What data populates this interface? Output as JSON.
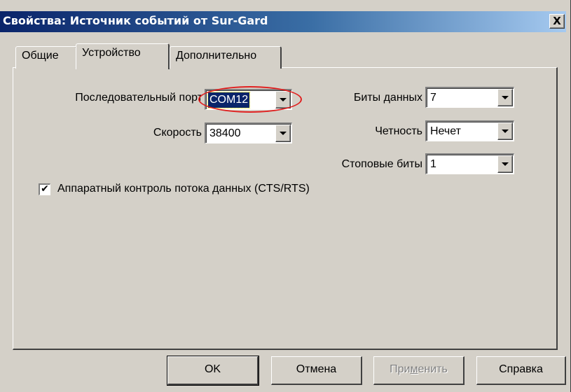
{
  "window": {
    "title": "Свойства: Источник событий от Sur-Gard",
    "close_label": "X"
  },
  "tabs": [
    {
      "label": "Общие",
      "active": false
    },
    {
      "label": "Устройство",
      "active": true
    },
    {
      "label": "Дополнительно",
      "active": false
    }
  ],
  "device": {
    "serial_port": {
      "label": "Последовательный порт",
      "value": "COM12"
    },
    "speed": {
      "label": "Скорость",
      "value": "38400"
    },
    "data_bits": {
      "label": "Биты данных",
      "value": "7"
    },
    "parity": {
      "label": "Четность",
      "value": "Нечет"
    },
    "stop_bits": {
      "label": "Стоповые биты",
      "value": "1"
    },
    "flow_control": {
      "label": "Аппаратный контроль потока данных (CTS/RTS)",
      "checked": true,
      "mark": "✔"
    }
  },
  "buttons": {
    "ok": "OK",
    "cancel": "Отмена",
    "apply_before": "При",
    "apply_mnemonic": "м",
    "apply_after": "енить",
    "help": "Справка"
  },
  "colors": {
    "titlebar_start": "#0a246a",
    "titlebar_end": "#a6caf0",
    "window_face": "#d4d0c8",
    "selection": "#0a246a",
    "annotation": "#e02020"
  }
}
